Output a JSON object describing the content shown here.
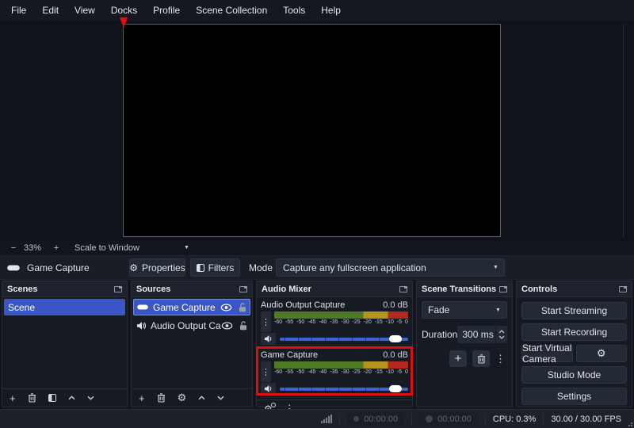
{
  "menu": {
    "items": [
      "File",
      "Edit",
      "View",
      "Docks",
      "Profile",
      "Scene Collection",
      "Tools",
      "Help"
    ]
  },
  "preview": {
    "zoom_out": "−",
    "zoom_level": "33%",
    "zoom_in": "+",
    "scale_mode": "Scale to Window"
  },
  "source_row": {
    "name": "Game Capture",
    "properties": "Properties",
    "filters": "Filters",
    "mode_label": "Mode",
    "mode_value": "Capture any fullscreen application"
  },
  "scenes": {
    "title": "Scenes",
    "scene": "Scene"
  },
  "sources": {
    "title": "Sources",
    "row1": "Game Capture",
    "row2": "Audio Output Captu"
  },
  "audio_mixer": {
    "title": "Audio Mixer",
    "mixer1": {
      "name": "Audio Output Capture",
      "db": "0.0 dB"
    },
    "mixer2": {
      "name": "Game Capture",
      "db": "0.0 dB"
    },
    "scale_ticks": [
      "-60",
      "-55",
      "-50",
      "-45",
      "-40",
      "-35",
      "-30",
      "-25",
      "-20",
      "-15",
      "-10",
      "-5",
      "0"
    ]
  },
  "transitions": {
    "title": "Scene Transitions",
    "value": "Fade",
    "duration_label": "Duration",
    "duration_value": "300 ms"
  },
  "controls": {
    "title": "Controls",
    "start_streaming": "Start Streaming",
    "start_recording": "Start Recording",
    "start_virtual_camera": "Start Virtual Camera",
    "studio_mode": "Studio Mode",
    "settings": "Settings"
  },
  "status": {
    "stream_time": "00:00:00",
    "record_time": "00:00:00",
    "cpu": "CPU: 0.3%",
    "fps": "30.00 / 30.00 FPS"
  },
  "glyphs": {
    "gear": "⚙",
    "kebab": "⋮",
    "plus": "+",
    "caret_down": "▼"
  },
  "colors": {
    "selection_blue": "#3a56c6",
    "meter_green": "#4e7c24",
    "meter_yellow": "#b4941e",
    "meter_red": "#b02a20",
    "slider_blue": "#3d63d8",
    "annotation_red": "#dd0f0f"
  }
}
